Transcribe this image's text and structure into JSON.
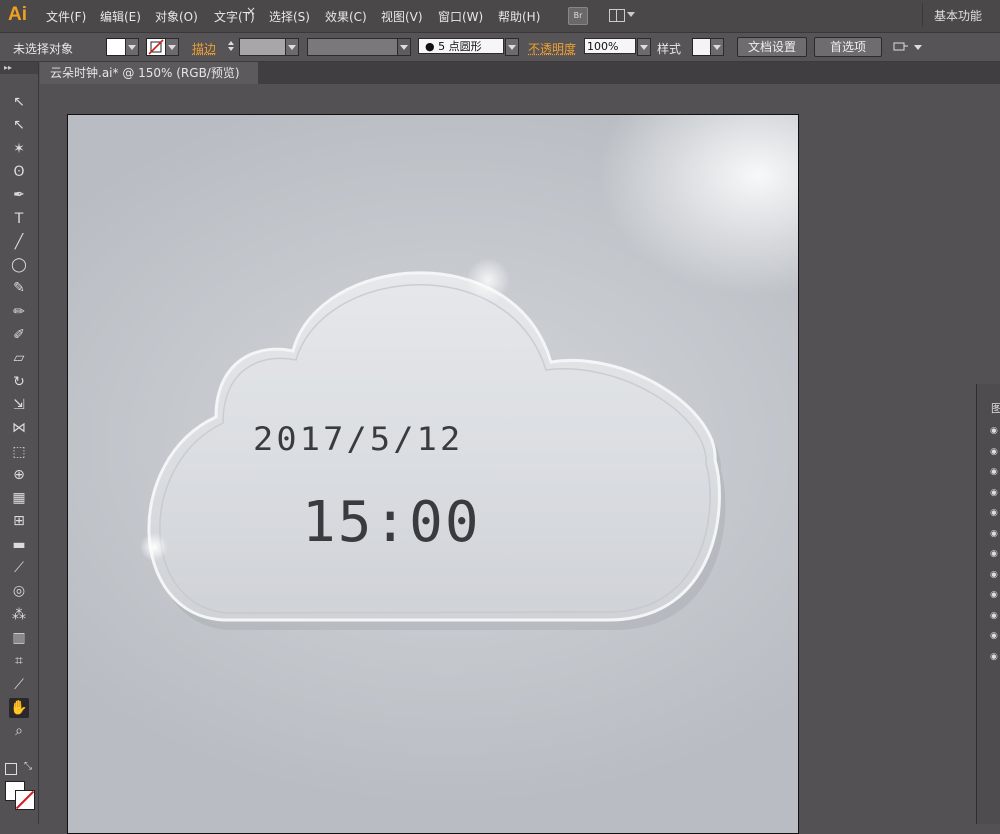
{
  "app": {
    "logo": "Ai"
  },
  "menu": [
    "文件(F)",
    "编辑(E)",
    "对象(O)",
    "文字(T)",
    "选择(S)",
    "效果(C)",
    "视图(V)",
    "窗口(W)",
    "帮助(H)"
  ],
  "menubar": {
    "bridge_label": "Br",
    "workspace": "基本功能"
  },
  "control": {
    "selection_state": "未选择对象",
    "stroke_label": "描边",
    "brush_label": "5 点圆形",
    "opacity_label": "不透明度",
    "opacity_value": "100%",
    "style_label": "样式",
    "doc_setup_button": "文档设置",
    "prefs_button": "首选项"
  },
  "document": {
    "tab_title": "云朵时钟.ai* @ 150% (RGB/预览)",
    "close": "×"
  },
  "clock": {
    "date": "2017/5/12",
    "time": "15:00"
  },
  "tools": [
    {
      "name": "selection-tool-icon",
      "glyph": "↖"
    },
    {
      "name": "direct-selection-tool-icon",
      "glyph": "↖"
    },
    {
      "name": "magic-wand-tool-icon",
      "glyph": "✶"
    },
    {
      "name": "lasso-tool-icon",
      "glyph": "ʘ"
    },
    {
      "name": "pen-tool-icon",
      "glyph": "✒"
    },
    {
      "name": "type-tool-icon",
      "glyph": "T"
    },
    {
      "name": "line-tool-icon",
      "glyph": "╱"
    },
    {
      "name": "ellipse-tool-icon",
      "glyph": "◯"
    },
    {
      "name": "paintbrush-tool-icon",
      "glyph": "✎"
    },
    {
      "name": "pencil-tool-icon",
      "glyph": "✏"
    },
    {
      "name": "blob-brush-tool-icon",
      "glyph": "✐"
    },
    {
      "name": "eraser-tool-icon",
      "glyph": "▱"
    },
    {
      "name": "rotate-tool-icon",
      "glyph": "↻"
    },
    {
      "name": "scale-tool-icon",
      "glyph": "⇲"
    },
    {
      "name": "width-tool-icon",
      "glyph": "⋈"
    },
    {
      "name": "free-transform-tool-icon",
      "glyph": "⬚"
    },
    {
      "name": "shape-builder-tool-icon",
      "glyph": "⊕"
    },
    {
      "name": "perspective-grid-tool-icon",
      "glyph": "▦"
    },
    {
      "name": "mesh-tool-icon",
      "glyph": "⊞"
    },
    {
      "name": "gradient-tool-icon",
      "glyph": "▬"
    },
    {
      "name": "eyedropper-tool-icon",
      "glyph": "⟋"
    },
    {
      "name": "blend-tool-icon",
      "glyph": "◎"
    },
    {
      "name": "symbol-sprayer-tool-icon",
      "glyph": "⁂"
    },
    {
      "name": "column-graph-tool-icon",
      "glyph": "▥"
    },
    {
      "name": "artboard-tool-icon",
      "glyph": "⌗"
    },
    {
      "name": "slice-tool-icon",
      "glyph": "⟋"
    },
    {
      "name": "hand-tool-icon",
      "glyph": "✋"
    },
    {
      "name": "zoom-tool-icon",
      "glyph": "⌕"
    }
  ],
  "colors": {
    "accent": "#f0a020",
    "ui_dark": "#4a4849",
    "canvas_bg": "#535153"
  }
}
